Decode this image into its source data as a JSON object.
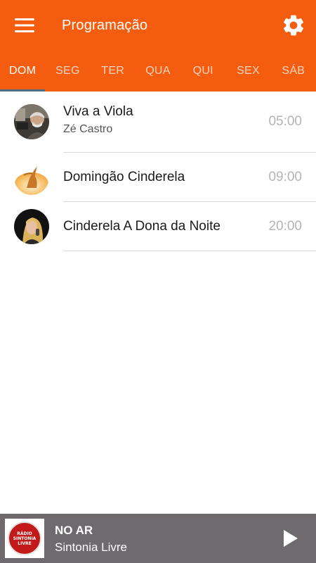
{
  "app": {
    "title": "Programação",
    "accent_color": "#f45d10",
    "menu_icon": "hamburger-menu-icon",
    "settings_icon": "gear-icon"
  },
  "tabs": [
    {
      "label": "DOM",
      "active": true
    },
    {
      "label": "SEG",
      "active": false
    },
    {
      "label": "TER",
      "active": false
    },
    {
      "label": "QUA",
      "active": false
    },
    {
      "label": "QUI",
      "active": false
    },
    {
      "label": "SEX",
      "active": false
    },
    {
      "label": "SÁB",
      "active": false
    }
  ],
  "programs": [
    {
      "title": "Viva a Viola",
      "host": "Zé Castro",
      "time": "05:00"
    },
    {
      "title": "Domingão Cinderela",
      "host": "",
      "time": "09:00"
    },
    {
      "title": "Cinderela A Dona da Noite",
      "host": "",
      "time": "20:00"
    }
  ],
  "player": {
    "status": "NO AR",
    "station": "Sintonia Livre",
    "logo_text": [
      "RÁDIO",
      "SINTONIA",
      "LIVRE"
    ],
    "play_icon": "play-icon"
  }
}
